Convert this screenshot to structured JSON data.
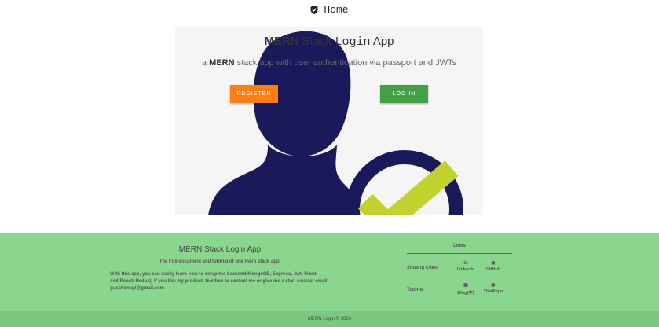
{
  "nav": {
    "home_label": "Home",
    "home_icon": "shield-check-icon"
  },
  "hero": {
    "title_bold": "MERN",
    "title_stack": " Stack ",
    "title_mono": "Login",
    "title_rest": " App",
    "subtitle_prefix": "a ",
    "subtitle_bold": "MERN",
    "subtitle_rest": " stack app with user authentication via passport and JWTs",
    "register_label": "REGISTER",
    "login_label": "LOG IN",
    "colors": {
      "illustration": "#1a1a5a",
      "check": "#c1d22f",
      "register": "#ff7f17",
      "login": "#43a047"
    }
  },
  "footer": {
    "title": "MERN Stack Login App",
    "subtitle": "The Full document and tutorial of one mern stack app.",
    "body": "With this app, you can easily learn how to setup the backend(MongoDB, Express, Jwt) Front end(React/ Redux). If you like my product, feel free to contact me or give me a star! contact email: guschenepi@gmail.com",
    "links_heading": "Links",
    "rows": [
      {
        "label": "Shuang Chen",
        "links": [
          {
            "icon": "linkedin-icon",
            "glyph": "in",
            "text": "LinkedIn"
          },
          {
            "icon": "github-icon",
            "glyph": "◉",
            "text": "GitHub"
          }
        ]
      },
      {
        "label": "Tutorial",
        "links": [
          {
            "icon": "blog-icon",
            "glyph": "▣",
            "text": "Blog(中)"
          },
          {
            "icon": "github-icon",
            "glyph": "◉",
            "text": "ThisRepo"
          }
        ]
      }
    ],
    "copyright": "MERN Login © 2020",
    "colors": {
      "background": "#8ad68f",
      "bottom_bar": "#7bc980"
    }
  }
}
